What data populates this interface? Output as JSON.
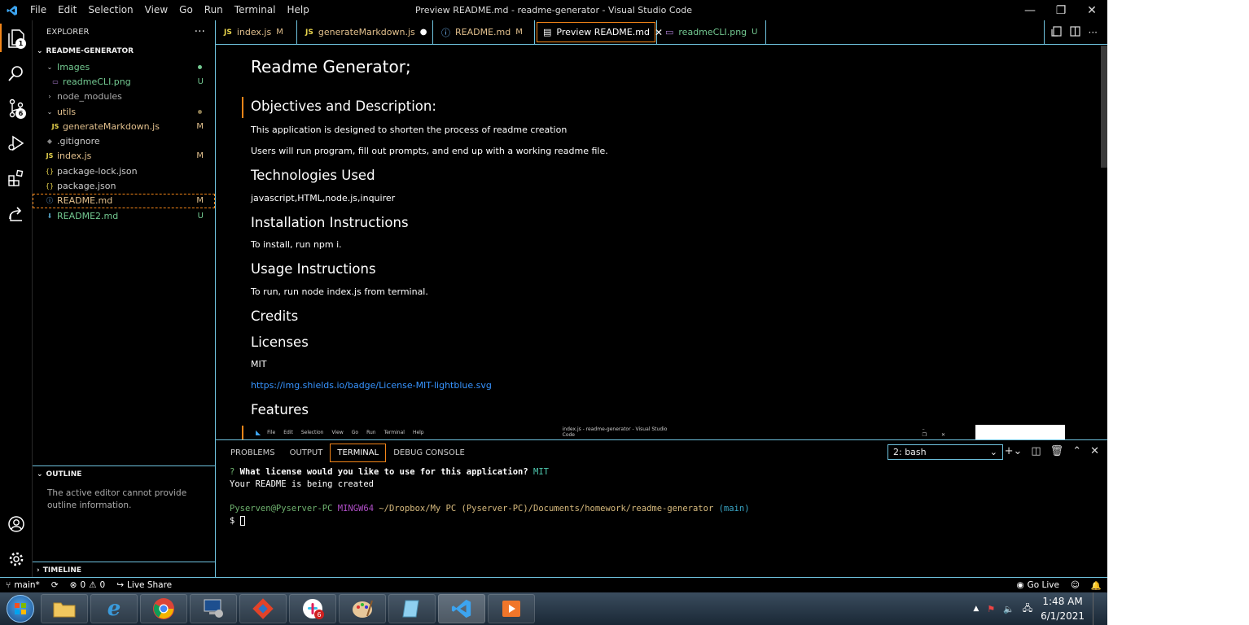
{
  "window": {
    "title": "Preview README.md - readme-generator - Visual Studio Code",
    "menu": [
      "File",
      "Edit",
      "Selection",
      "View",
      "Go",
      "Run",
      "Terminal",
      "Help"
    ]
  },
  "activity": {
    "scm_badge": "6",
    "explorer_badge": "1"
  },
  "explorer": {
    "header": "EXPLORER",
    "more": "···",
    "root": "README-GENERATOR",
    "items": [
      {
        "label": "Images",
        "status": "",
        "color": "#73c991"
      },
      {
        "label": "readmeCLI.png",
        "status": "U",
        "color": "#73c991"
      },
      {
        "label": "node_modules",
        "status": "",
        "color": "#aaaaaa"
      },
      {
        "label": "utils",
        "status": "",
        "color": "#e2c08d"
      },
      {
        "label": "generateMarkdown.js",
        "status": "M",
        "color": "#e2c08d"
      },
      {
        "label": ".gitignore",
        "status": "",
        "color": "#cccccc"
      },
      {
        "label": "index.js",
        "status": "M",
        "color": "#e2c08d"
      },
      {
        "label": "package-lock.json",
        "status": "",
        "color": "#cccccc"
      },
      {
        "label": "package.json",
        "status": "",
        "color": "#cccccc"
      },
      {
        "label": "README.md",
        "status": "M",
        "color": "#e2c08d"
      },
      {
        "label": "README2.md",
        "status": "U",
        "color": "#73c991"
      }
    ],
    "outline_title": "OUTLINE",
    "outline_msg": "The active editor cannot provide outline information.",
    "timeline_title": "TIMELINE"
  },
  "tabs": [
    {
      "label": "index.js",
      "tag": "M",
      "icon": "JS"
    },
    {
      "label": "generateMarkdown.js",
      "tag": "●",
      "icon": "JS"
    },
    {
      "label": "README.md",
      "tag": "M",
      "icon": "ⓘ"
    },
    {
      "label": "Preview README.md",
      "tag": "✕",
      "icon": "▤"
    },
    {
      "label": "readmeCLI.png",
      "tag": "U",
      "icon": "▭"
    }
  ],
  "preview": {
    "h1": "Readme Generator;",
    "objectives": "Objectives and Description:",
    "obj_p1": "This application is designed to shorten the process of readme creation",
    "obj_p2": "Users will run program, fill out prompts, and end up with a working readme file.",
    "tech": "Technologies Used",
    "tech_p": "javascript,HTML,node.js,inquirer",
    "install": "Installation Instructions",
    "install_p": "To install, run npm i.",
    "usage": "Usage Instructions",
    "usage_p": "To run, run node index.js from terminal.",
    "credits": "Credits",
    "licenses": "Licenses",
    "license_p": "MIT",
    "license_link": "https://img.shields.io/badge/License-MIT-lightblue.svg",
    "features": "Features",
    "embedded_menu": [
      "File",
      "Edit",
      "Selection",
      "View",
      "Go",
      "Run",
      "Terminal",
      "Help"
    ],
    "embedded_title": "index.js - readme-generator - Visual Studio Code"
  },
  "panel": {
    "tabs": [
      "PROBLEMS",
      "OUTPUT",
      "TERMINAL",
      "DEBUG CONSOLE"
    ],
    "shell": "2: bash",
    "q_mark": "?",
    "q_text": "What license would you like to use for this application?",
    "q_answer": "MIT",
    "created": "Your README is being created",
    "user": "Pyserven@Pyserver-PC",
    "shell_name": "MINGW64",
    "path": "~/Dropbox/My PC (Pyserver-PC)/Documents/homework/readme-generator",
    "branch": "(main)",
    "prompt": "$"
  },
  "status": {
    "branch": "main*",
    "errors": "0",
    "warnings": "0",
    "live_share": "Live Share",
    "go_live": "Go Live"
  },
  "taskbar": {
    "time": "1:48 AM",
    "date": "6/1/2021",
    "slack_badge": "6"
  }
}
